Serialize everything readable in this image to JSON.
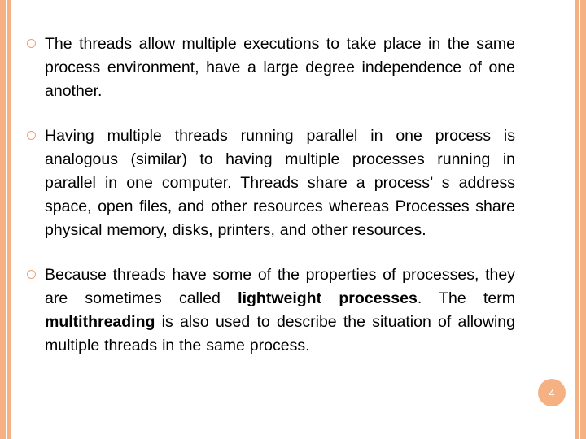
{
  "slide": {
    "page_number": "4",
    "accent_color": "#f6b183",
    "bullet_marker_color": "#f0a070",
    "text_color": "#000000",
    "background_color": "#ffffff",
    "bullets": [
      {
        "marker": "ring-bullet-icon",
        "segments": [
          {
            "text": "The threads allow multiple executions to take place in the same process environment, have a large degree independence of one another.",
            "bold": false
          }
        ]
      },
      {
        "marker": "ring-bullet-icon",
        "segments": [
          {
            "text": "Having multiple threads running parallel in one process is analogous (similar) to having multiple processes running in parallel in one computer. Threads share a process’ s address space, open files, and other resources whereas Processes share physical memory, disks, printers, and other resources.",
            "bold": false
          }
        ]
      },
      {
        "marker": "ring-bullet-icon",
        "segments": [
          {
            "text": "Because threads have some of the properties of processes, they are sometimes called ",
            "bold": false
          },
          {
            "text": "lightweight processes",
            "bold": true
          },
          {
            "text": ". The term ",
            "bold": false
          },
          {
            "text": "multithreading",
            "bold": true
          },
          {
            "text": " is also used to describe the situation of allowing multiple threads in the same process.",
            "bold": false
          }
        ]
      }
    ]
  }
}
